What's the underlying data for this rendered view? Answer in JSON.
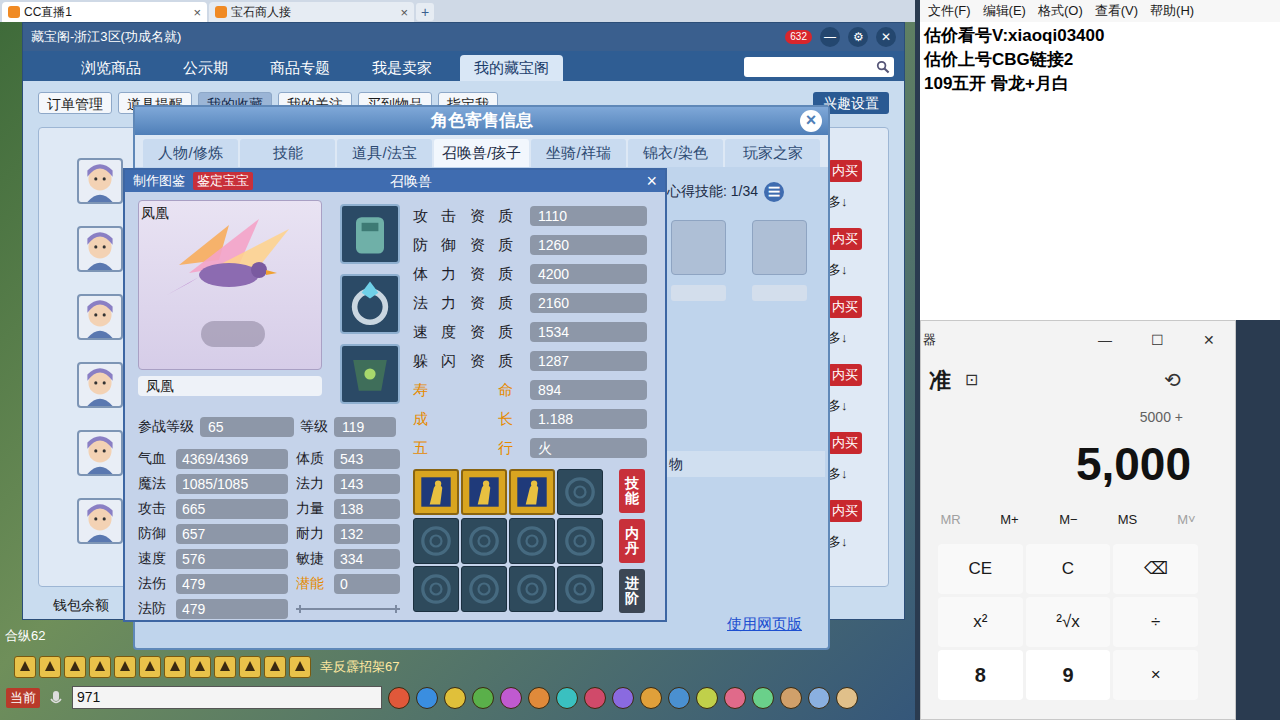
{
  "browser": {
    "tabs": [
      {
        "label": "CC直播1",
        "selected": true
      },
      {
        "label": "宝石商人接",
        "selected": false
      }
    ],
    "close": "×",
    "new_tab": "+"
  },
  "notepad": {
    "menu": [
      "文件(F)",
      "编辑(E)",
      "格式(O)",
      "查看(V)",
      "帮助(H)"
    ],
    "lines": [
      "估价看号V:xiaoqi03400",
      "估价上号CBG链接2",
      "109五开 骨龙+月白"
    ]
  },
  "calculator": {
    "title": "器",
    "controls": [
      "—",
      "☐",
      "✕"
    ],
    "mode": "准",
    "pin": "⊡",
    "history": "⟲",
    "expression": "5000 +",
    "display": "5,000",
    "memory": [
      {
        "label": "MR",
        "disabled": true
      },
      {
        "label": "M+",
        "disabled": false
      },
      {
        "label": "M−",
        "disabled": false
      },
      {
        "label": "MS",
        "disabled": false
      },
      {
        "label": "M˅",
        "disabled": true
      }
    ],
    "keys": [
      {
        "label": "CE",
        "kind": "op"
      },
      {
        "label": "C",
        "kind": "op"
      },
      {
        "label": "⌫",
        "kind": "op"
      },
      {
        "label": "x²",
        "kind": "op"
      },
      {
        "label": "²√x",
        "kind": "op"
      },
      {
        "label": "÷",
        "kind": "op"
      },
      {
        "label": "8",
        "kind": "digit"
      },
      {
        "label": "9",
        "kind": "digit"
      },
      {
        "label": "×",
        "kind": "op"
      }
    ]
  },
  "cbg": {
    "title": "藏宝阁-浙江3区(功成名就)",
    "cart_count": "632",
    "window_controls": [
      "—",
      "⚙",
      "✕"
    ],
    "nav": [
      {
        "label": "浏览商品",
        "selected": false
      },
      {
        "label": "公示期",
        "selected": false
      },
      {
        "label": "商品专题",
        "selected": false
      },
      {
        "label": "我是卖家",
        "selected": false
      },
      {
        "label": "我的藏宝阁",
        "selected": true
      }
    ],
    "subnav": [
      {
        "label": "订单管理",
        "selected": false
      },
      {
        "label": "道具提醒",
        "selected": false
      },
      {
        "label": "我的收藏",
        "selected": true
      },
      {
        "label": "我的关注",
        "selected": false
      },
      {
        "label": "买到物品",
        "selected": false
      },
      {
        "label": "指定我",
        "selected": false
      }
    ],
    "interest_button": "兴趣设置",
    "list_rows": [
      {
        "buy": "内买",
        "more": "多↓"
      },
      {
        "buy": "内买",
        "more": "多↓"
      },
      {
        "buy": "内买",
        "more": "多↓"
      },
      {
        "buy": "内买",
        "more": "多↓"
      },
      {
        "buy": "内买",
        "more": "多↓"
      },
      {
        "buy": "内买",
        "more": "多↓"
      }
    ],
    "wallet_label": "钱包余额"
  },
  "dialog": {
    "title": "角色寄售信息",
    "close": "×",
    "tabs": [
      {
        "label": "人物/修炼",
        "selected": false
      },
      {
        "label": "技能",
        "selected": false
      },
      {
        "label": "道具/法宝",
        "selected": false
      },
      {
        "label": "召唤兽/孩子",
        "selected": true
      },
      {
        "label": "坐骑/祥瑞",
        "selected": false
      },
      {
        "label": "锦衣/染色",
        "selected": false
      },
      {
        "label": "玩家之家",
        "selected": false
      }
    ],
    "insight_label": "心得技能: 1/34",
    "menu_icon": "☰",
    "band_label": "物",
    "web_link": "使用网页版"
  },
  "pet": {
    "header_buttons": [
      {
        "label": "制作图鉴",
        "kind": "plain"
      },
      {
        "label": "鉴定宝宝",
        "kind": "accent"
      }
    ],
    "title": "召唤兽",
    "close": "×",
    "name_tag": "凤凰",
    "name": "凤凰",
    "levels": [
      {
        "label": "参战等级",
        "value": "65"
      },
      {
        "label": "等级",
        "value": "119"
      }
    ],
    "stats_left": [
      {
        "label": "气血",
        "value": "4369/4369"
      },
      {
        "label": "魔法",
        "value": "1085/1085"
      },
      {
        "label": "攻击",
        "value": "665"
      },
      {
        "label": "防御",
        "value": "657"
      },
      {
        "label": "速度",
        "value": "576"
      },
      {
        "label": "法伤",
        "value": "479"
      },
      {
        "label": "法防",
        "value": "479"
      }
    ],
    "stats_right": [
      {
        "label": "体质",
        "value": "543",
        "highlight": false
      },
      {
        "label": "法力",
        "value": "143",
        "highlight": false
      },
      {
        "label": "力量",
        "value": "138",
        "highlight": false
      },
      {
        "label": "耐力",
        "value": "132",
        "highlight": false
      },
      {
        "label": "敏捷",
        "value": "334",
        "highlight": false
      },
      {
        "label": "潜能",
        "value": "0",
        "highlight": true
      }
    ],
    "aptitudes": [
      {
        "label": "攻击资质",
        "value": "1110",
        "highlight": false
      },
      {
        "label": "防御资质",
        "value": "1260",
        "highlight": false
      },
      {
        "label": "体力资质",
        "value": "4200",
        "highlight": false
      },
      {
        "label": "法力资质",
        "value": "2160",
        "highlight": false
      },
      {
        "label": "速度资质",
        "value": "1534",
        "highlight": false
      },
      {
        "label": "躲闪资质",
        "value": "1287",
        "highlight": false
      },
      {
        "label": "寿命",
        "value": "894",
        "highlight": true
      },
      {
        "label": "成长",
        "value": "1.188",
        "highlight": true
      },
      {
        "label": "五行",
        "value": "火",
        "highlight": true
      }
    ],
    "skills": [
      {
        "kind": "skill"
      },
      {
        "kind": "skill"
      },
      {
        "kind": "skill"
      },
      {
        "kind": "empty"
      },
      {
        "kind": "empty"
      },
      {
        "kind": "empty"
      },
      {
        "kind": "empty"
      },
      {
        "kind": "empty"
      },
      {
        "kind": "empty"
      },
      {
        "kind": "empty"
      },
      {
        "kind": "empty"
      },
      {
        "kind": "empty"
      }
    ],
    "side_buttons": [
      {
        "label": "技能",
        "color": "#c8303a"
      },
      {
        "label": "内丹",
        "color": "#c8303a"
      },
      {
        "label": "进阶",
        "color": "#3c4654"
      }
    ]
  },
  "game": {
    "chat_lines": [
      "合纵62",
      "幸反霹招架67"
    ],
    "channel": "当前",
    "input": "971"
  }
}
